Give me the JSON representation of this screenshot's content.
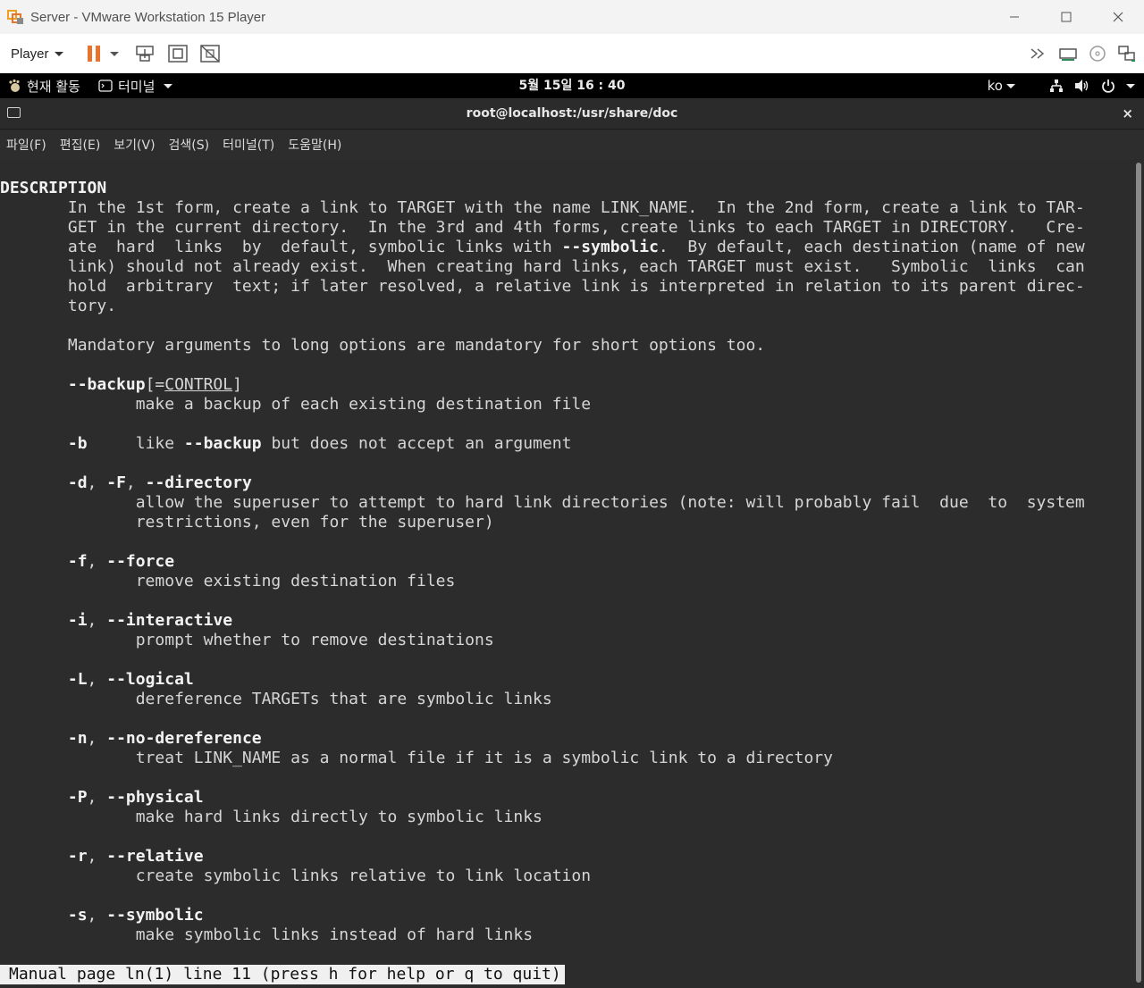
{
  "window": {
    "title": "Server - VMware Workstation 15 Player"
  },
  "toolbar": {
    "player_label": "Player",
    "icons": [
      "pause-icon",
      "send-ctrl-alt-del-icon",
      "fit-guest-icon",
      "unity-icon",
      "more-icon",
      "removable-device-icon",
      "cd-icon",
      "network-adapter-icon"
    ],
    "accent_color": "#e8732c"
  },
  "gnome_bar": {
    "activities": "현재 활동",
    "app_menu": "터미널",
    "clock": "5월 15일  16 : 40",
    "input_method": "ko"
  },
  "terminal": {
    "title": "root@localhost:/usr/share/doc",
    "close_glyph": "×",
    "menu": [
      "파일(F)",
      "편집(E)",
      "보기(V)",
      "검색(S)",
      "터미널(T)",
      "도움말(H)"
    ],
    "lines": [
      [
        [
          "DESCRIPTION",
          "b"
        ]
      ],
      [
        [
          "       In the 1st form, create a link to TARGET with the name LINK_NAME.  In the 2nd form, create a link to TAR-",
          ""
        ]
      ],
      [
        [
          "       GET in the current directory.  In the 3rd and 4th forms, create links to each TARGET in DIRECTORY.   Cre-",
          ""
        ]
      ],
      [
        [
          "       ate  hard  links  by  default, symbolic links with ",
          ""
        ],
        [
          "--symbolic",
          "b"
        ],
        [
          ".  By default, each destination (name of new",
          ""
        ]
      ],
      [
        [
          "       link) should not already exist.  When creating hard links, each TARGET must exist.   Symbolic  links  can",
          ""
        ]
      ],
      [
        [
          "       hold  arbitrary  text; if later resolved, a relative link is interpreted in relation to its parent direc-",
          ""
        ]
      ],
      [
        [
          "       tory.",
          ""
        ]
      ],
      [],
      [
        [
          "       Mandatory arguments to long options are mandatory for short options too.",
          ""
        ]
      ],
      [],
      [
        [
          "       ",
          ""
        ],
        [
          "--backup",
          "b"
        ],
        [
          "[=",
          ""
        ],
        [
          "CONTROL",
          "u"
        ],
        [
          "]",
          ""
        ]
      ],
      [
        [
          "              make a backup of each existing destination file",
          ""
        ]
      ],
      [],
      [
        [
          "       ",
          ""
        ],
        [
          "-b",
          "b"
        ],
        [
          "     like ",
          ""
        ],
        [
          "--backup",
          "b"
        ],
        [
          " but does not accept an argument",
          ""
        ]
      ],
      [],
      [
        [
          "       ",
          ""
        ],
        [
          "-d",
          "b"
        ],
        [
          ", ",
          ""
        ],
        [
          "-F",
          "b"
        ],
        [
          ", ",
          ""
        ],
        [
          "--directory",
          "b"
        ]
      ],
      [
        [
          "              allow the superuser to attempt to hard link directories (note: will probably fail  due  to  system",
          ""
        ]
      ],
      [
        [
          "              restrictions, even for the superuser)",
          ""
        ]
      ],
      [],
      [
        [
          "       ",
          ""
        ],
        [
          "-f",
          "b"
        ],
        [
          ", ",
          ""
        ],
        [
          "--force",
          "b"
        ]
      ],
      [
        [
          "              remove existing destination files",
          ""
        ]
      ],
      [],
      [
        [
          "       ",
          ""
        ],
        [
          "-i",
          "b"
        ],
        [
          ", ",
          ""
        ],
        [
          "--interactive",
          "b"
        ]
      ],
      [
        [
          "              prompt whether to remove destinations",
          ""
        ]
      ],
      [],
      [
        [
          "       ",
          ""
        ],
        [
          "-L",
          "b"
        ],
        [
          ", ",
          ""
        ],
        [
          "--logical",
          "b"
        ]
      ],
      [
        [
          "              dereference TARGETs that are symbolic links",
          ""
        ]
      ],
      [],
      [
        [
          "       ",
          ""
        ],
        [
          "-n",
          "b"
        ],
        [
          ", ",
          ""
        ],
        [
          "--no-dereference",
          "b"
        ]
      ],
      [
        [
          "              treat LINK_NAME as a normal file if it is a symbolic link to a directory",
          ""
        ]
      ],
      [],
      [
        [
          "       ",
          ""
        ],
        [
          "-P",
          "b"
        ],
        [
          ", ",
          ""
        ],
        [
          "--physical",
          "b"
        ]
      ],
      [
        [
          "              make hard links directly to symbolic links",
          ""
        ]
      ],
      [],
      [
        [
          "       ",
          ""
        ],
        [
          "-r",
          "b"
        ],
        [
          ", ",
          ""
        ],
        [
          "--relative",
          "b"
        ]
      ],
      [
        [
          "              create symbolic links relative to link location",
          ""
        ]
      ],
      [],
      [
        [
          "       ",
          ""
        ],
        [
          "-s",
          "b"
        ],
        [
          ", ",
          ""
        ],
        [
          "--symbolic",
          "b"
        ]
      ],
      [
        [
          "              make symbolic links instead of hard links",
          ""
        ]
      ]
    ],
    "status": "Manual page ln(1) line 11 (press h for help or q to quit)"
  }
}
